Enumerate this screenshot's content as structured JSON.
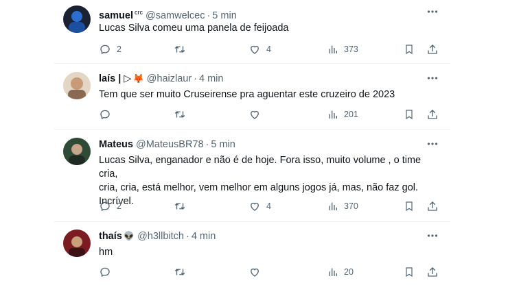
{
  "tweets": [
    {
      "name": "samuel",
      "badge": "crc",
      "emoji": "",
      "handle": "@samwelcec",
      "time": "5 min",
      "lines": [
        "Lucas Silva comeu uma panela de feijoada"
      ],
      "replies": "2",
      "retweets": "",
      "likes": "4",
      "views": "373",
      "avatar_colors": [
        "#1d2b48",
        "#2c6fd1"
      ]
    },
    {
      "name": "laís | ▷",
      "badge": "",
      "emoji": "🦊",
      "handle": "@haizlaur",
      "time": "4 min",
      "lines": [
        "Tem que ser muito Cruseirense pra aguentar este cruzeiro de 2023"
      ],
      "replies": "",
      "retweets": "",
      "likes": "",
      "views": "201",
      "avatar_colors": [
        "#d9b99a",
        "#8a6a52"
      ]
    },
    {
      "name": "Mateus",
      "badge": "",
      "emoji": "",
      "handle": "@MateusBR78",
      "time": "5 min",
      "lines": [
        "Lucas Silva, enganador e não é de hoje. Fora isso, muito volume , o time cria,",
        "cria, cria, está melhor, vem melhor em alguns jogos já, mas, não faz gol.",
        "Incrível."
      ],
      "replies": "2",
      "retweets": "",
      "likes": "4",
      "views": "370",
      "avatar_colors": [
        "#2f4a36",
        "#c7a58a"
      ]
    },
    {
      "name": "thaís",
      "badge": "",
      "emoji": "👽",
      "handle": "@h3llbitch",
      "time": "4 min",
      "lines": [
        "hm"
      ],
      "replies": "",
      "retweets": "",
      "likes": "",
      "views": "20",
      "avatar_colors": [
        "#7a1c22",
        "#c9a07a"
      ]
    }
  ],
  "icons": {
    "reply": "reply-icon",
    "retweet": "retweet-icon",
    "like": "heart-icon",
    "views": "views-icon",
    "bookmark": "bookmark-icon",
    "share": "share-icon",
    "more": "more-icon"
  },
  "colors": {
    "text": "#0f1419",
    "muted": "#536471",
    "divider": "#eff3f4"
  }
}
